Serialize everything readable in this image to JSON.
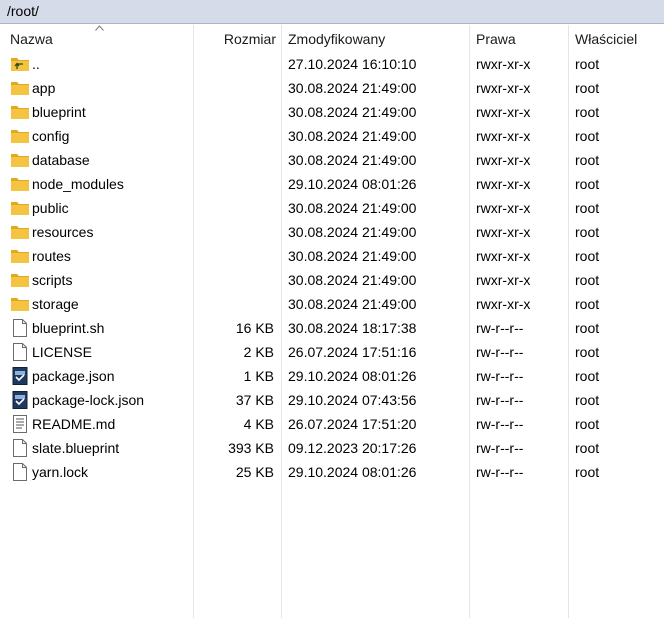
{
  "path": "/root/",
  "columns": {
    "name": "Nazwa",
    "size": "Rozmiar",
    "modified": "Zmodyfikowany",
    "perms": "Prawa",
    "owner": "Właściciel"
  },
  "files": [
    {
      "name": "..",
      "type": "parent",
      "icon": "parent-folder-icon",
      "size": "",
      "modified": "27.10.2024 16:10:10",
      "perms": "rwxr-xr-x",
      "owner": "root"
    },
    {
      "name": "app",
      "type": "folder",
      "icon": "folder-icon",
      "size": "",
      "modified": "30.08.2024 21:49:00",
      "perms": "rwxr-xr-x",
      "owner": "root"
    },
    {
      "name": "blueprint",
      "type": "folder",
      "icon": "folder-icon",
      "size": "",
      "modified": "30.08.2024 21:49:00",
      "perms": "rwxr-xr-x",
      "owner": "root"
    },
    {
      "name": "config",
      "type": "folder",
      "icon": "folder-icon",
      "size": "",
      "modified": "30.08.2024 21:49:00",
      "perms": "rwxr-xr-x",
      "owner": "root"
    },
    {
      "name": "database",
      "type": "folder",
      "icon": "folder-icon",
      "size": "",
      "modified": "30.08.2024 21:49:00",
      "perms": "rwxr-xr-x",
      "owner": "root"
    },
    {
      "name": "node_modules",
      "type": "folder",
      "icon": "folder-icon",
      "size": "",
      "modified": "29.10.2024 08:01:26",
      "perms": "rwxr-xr-x",
      "owner": "root"
    },
    {
      "name": "public",
      "type": "folder",
      "icon": "folder-icon",
      "size": "",
      "modified": "30.08.2024 21:49:00",
      "perms": "rwxr-xr-x",
      "owner": "root"
    },
    {
      "name": "resources",
      "type": "folder",
      "icon": "folder-icon",
      "size": "",
      "modified": "30.08.2024 21:49:00",
      "perms": "rwxr-xr-x",
      "owner": "root"
    },
    {
      "name": "routes",
      "type": "folder",
      "icon": "folder-icon",
      "size": "",
      "modified": "30.08.2024 21:49:00",
      "perms": "rwxr-xr-x",
      "owner": "root"
    },
    {
      "name": "scripts",
      "type": "folder",
      "icon": "folder-icon",
      "size": "",
      "modified": "30.08.2024 21:49:00",
      "perms": "rwxr-xr-x",
      "owner": "root"
    },
    {
      "name": "storage",
      "type": "folder",
      "icon": "folder-icon",
      "size": "",
      "modified": "30.08.2024 21:49:00",
      "perms": "rwxr-xr-x",
      "owner": "root"
    },
    {
      "name": "blueprint.sh",
      "type": "file",
      "icon": "file-icon",
      "size": "16 KB",
      "modified": "30.08.2024 18:17:38",
      "perms": "rw-r--r--",
      "owner": "root"
    },
    {
      "name": "LICENSE",
      "type": "file",
      "icon": "file-icon",
      "size": "2 KB",
      "modified": "26.07.2024 17:51:16",
      "perms": "rw-r--r--",
      "owner": "root"
    },
    {
      "name": "package.json",
      "type": "json",
      "icon": "json-file-icon",
      "size": "1 KB",
      "modified": "29.10.2024 08:01:26",
      "perms": "rw-r--r--",
      "owner": "root"
    },
    {
      "name": "package-lock.json",
      "type": "json",
      "icon": "json-file-icon",
      "size": "37 KB",
      "modified": "29.10.2024 07:43:56",
      "perms": "rw-r--r--",
      "owner": "root"
    },
    {
      "name": "README.md",
      "type": "text",
      "icon": "text-file-icon",
      "size": "4 KB",
      "modified": "26.07.2024 17:51:20",
      "perms": "rw-r--r--",
      "owner": "root"
    },
    {
      "name": "slate.blueprint",
      "type": "file",
      "icon": "file-icon",
      "size": "393 KB",
      "modified": "09.12.2023 20:17:26",
      "perms": "rw-r--r--",
      "owner": "root"
    },
    {
      "name": "yarn.lock",
      "type": "file",
      "icon": "file-icon",
      "size": "25 KB",
      "modified": "29.10.2024 08:01:26",
      "perms": "rw-r--r--",
      "owner": "root"
    }
  ],
  "colors": {
    "pathbar_bg": "#d6dbe9",
    "folder": "#f5c342",
    "json_icon": "#1e3a5f"
  }
}
